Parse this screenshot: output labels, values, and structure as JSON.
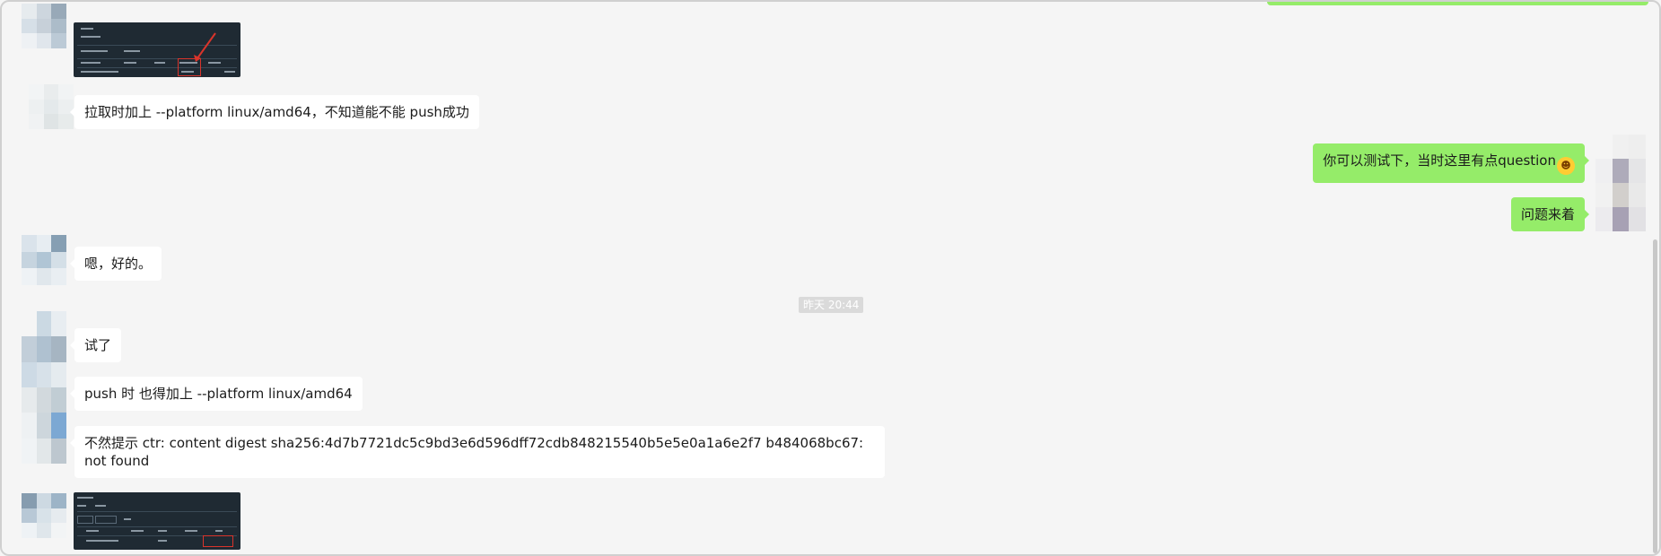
{
  "chat": {
    "messages": [
      {
        "side": "left",
        "type": "image",
        "alt": "screenshot"
      },
      {
        "side": "left",
        "type": "text",
        "text": "拉取时加上 --platform linux/amd64，不知道能不能 push成功"
      },
      {
        "side": "right",
        "type": "text",
        "text": "你可以测试下，当时这里有点question",
        "emoji": "grin-emoji"
      },
      {
        "side": "right",
        "type": "text",
        "text": "问题来着"
      },
      {
        "side": "left",
        "type": "text",
        "text": "嗯，好的。"
      },
      {
        "side": "left",
        "type": "text",
        "text": "试了"
      },
      {
        "side": "left",
        "type": "text",
        "text": "push 时 也得加上 --platform linux/amd64"
      },
      {
        "side": "left",
        "type": "text",
        "text": "不然提示 ctr: content digest sha256:4d7b7721dc5c9bd3e6d596dff72cdb848215540b5e5e0a1a6e2f7 b484068bc67: not found"
      },
      {
        "side": "left",
        "type": "image",
        "alt": "screenshot"
      }
    ],
    "timestamp": "昨天 20:44"
  },
  "colors": {
    "background": "#f5f5f5",
    "self_bubble": "#95ec69",
    "other_bubble": "#ffffff",
    "timestamp_bg": "#dadada"
  },
  "icons": {
    "emoji": "grin-emoji",
    "avatar": "pixelated-avatar"
  }
}
